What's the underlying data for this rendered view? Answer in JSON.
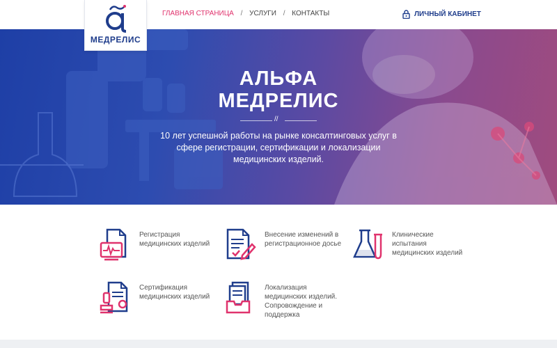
{
  "logo": {
    "text": "МЕДРЕЛИС"
  },
  "nav": {
    "items": [
      {
        "label": "ГЛАВНАЯ СТРАНИЦА",
        "active": true
      },
      {
        "label": "УСЛУГИ",
        "active": false
      },
      {
        "label": "КОНТАКТЫ",
        "active": false
      }
    ],
    "separator": "/"
  },
  "cabinet": {
    "label": "ЛИЧНЫЙ КАБИНЕТ",
    "icon": "lock-icon"
  },
  "hero": {
    "title_line1": "АЛЬФА",
    "title_line2": "МЕДРЕЛИС",
    "divider_mark": "//",
    "subtitle": "10 лет успешной работы на рынке консалтинговых услуг в сфере регистрации, сертификации и локализации медицинских изделий."
  },
  "services": [
    {
      "label": "Регистрация медицинских изделий",
      "icon": "document-chart-icon"
    },
    {
      "label": "Внесение изменений в регистрационное досье",
      "icon": "document-edit-icon"
    },
    {
      "label": "Клинические испытания медицинских изделий",
      "icon": "flask-icon"
    },
    {
      "label": "Сертификация медицинских изделий",
      "icon": "certificate-stamp-icon"
    },
    {
      "label": "Локализация медицинских изделий. Сопровождение и поддержка",
      "icon": "document-tray-icon"
    }
  ],
  "colors": {
    "brand_blue": "#1f3d8c",
    "accent_pink": "#e0336d"
  }
}
